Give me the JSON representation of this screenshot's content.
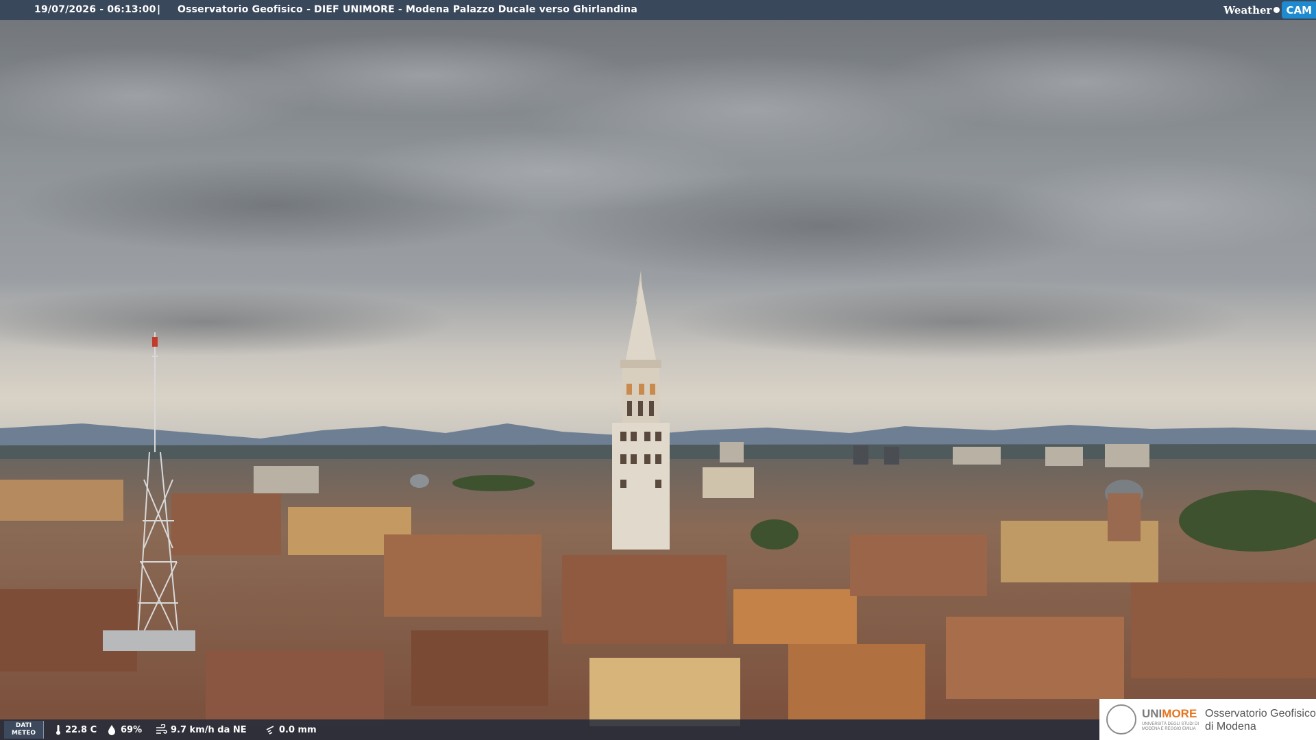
{
  "header": {
    "timestamp": "19/07/2026 - 06:13:00",
    "separator": "|",
    "title": "Osservatorio Geofisico - DIEF UNIMORE - Modena Palazzo Ducale verso Ghirlandina",
    "brand_weather": "Weather",
    "brand_cam": "CAM"
  },
  "weather": {
    "label_line1": "DATI",
    "label_line2": "METEO",
    "temperature": "22.8 C",
    "humidity": "69%",
    "wind": "9.7 km/h da NE",
    "rain": "0.0 mm",
    "icons": [
      "thermometer-icon",
      "humidity-drop-icon",
      "wind-icon",
      "rain-icon"
    ]
  },
  "logo": {
    "uni": "UNI",
    "more": "MORE",
    "sub_line1": "UNIVERSITÀ DEGLI STUDI DI",
    "sub_line2": "MODENA E REGGIO EMILIA",
    "observatory_line1": "Osservatorio Geofisico",
    "observatory_line2": "di Modena"
  },
  "colors": {
    "header_bar": "#2e3e54",
    "brand_blue": "#1e8bd1",
    "unimore_orange": "#e5751f",
    "sky": "#8b9096",
    "roofs": "#9a6a4c"
  }
}
